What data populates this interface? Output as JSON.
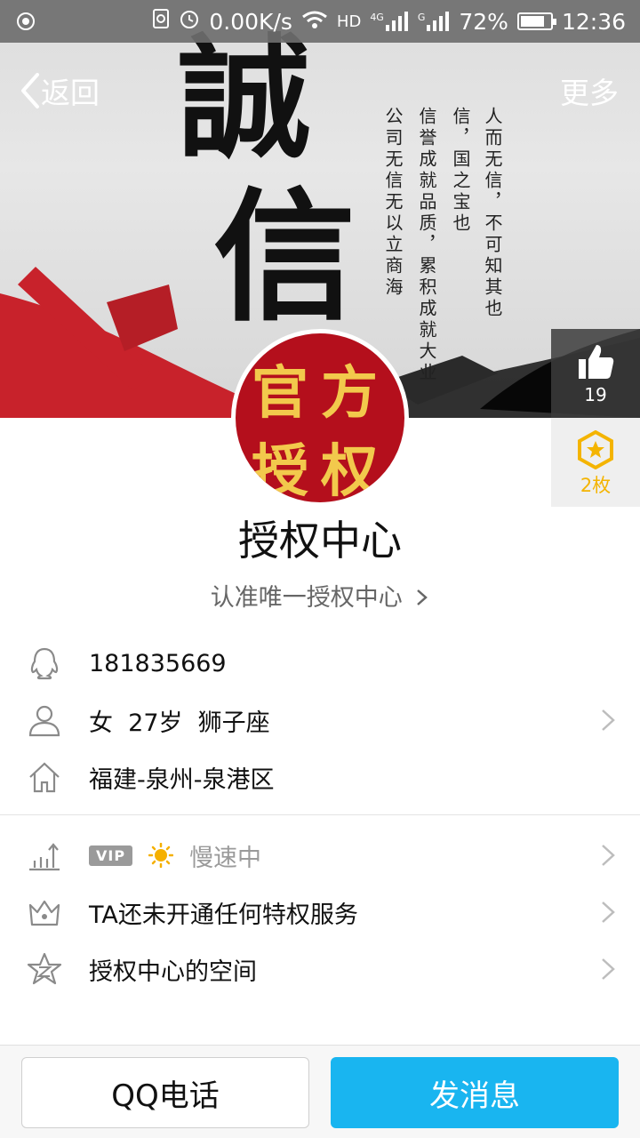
{
  "status_bar": {
    "speed": "0.00K/s",
    "network": "HD",
    "signal_1": "4G",
    "signal_2": "G",
    "battery": "72%",
    "battery_level": 0.72,
    "time": "12:36"
  },
  "nav": {
    "back_label": "返回",
    "more_label": "更多"
  },
  "cover": {
    "big_chars": [
      "誠",
      "信"
    ],
    "poem_lines": [
      "人而无信，不可知其也",
      "信，国之宝也",
      "信誉成就品质，累积成就大业",
      "公司无信无以立商海"
    ]
  },
  "side_panel": {
    "like_count": "19",
    "badge_count": "2枚"
  },
  "avatar": {
    "chars": [
      "官",
      "方",
      "授",
      "权"
    ]
  },
  "profile": {
    "name": "授权中心",
    "signature": "认准唯一授权中心"
  },
  "info": {
    "qq_number": "181835669",
    "gender_age_sign": "女  27岁  狮子座",
    "location": "福建-泉州-泉港区"
  },
  "privileges": {
    "vip_badge": "VIP",
    "level_status": "慢速中",
    "service_text": "TA还未开通任何特权服务",
    "space_text": "授权中心的空间"
  },
  "actions": {
    "call_label": "QQ电话",
    "message_label": "发消息"
  },
  "colors": {
    "accent": "#19b5f0",
    "badge_gold": "#f4b400",
    "avatar_red": "#b40f1c"
  }
}
